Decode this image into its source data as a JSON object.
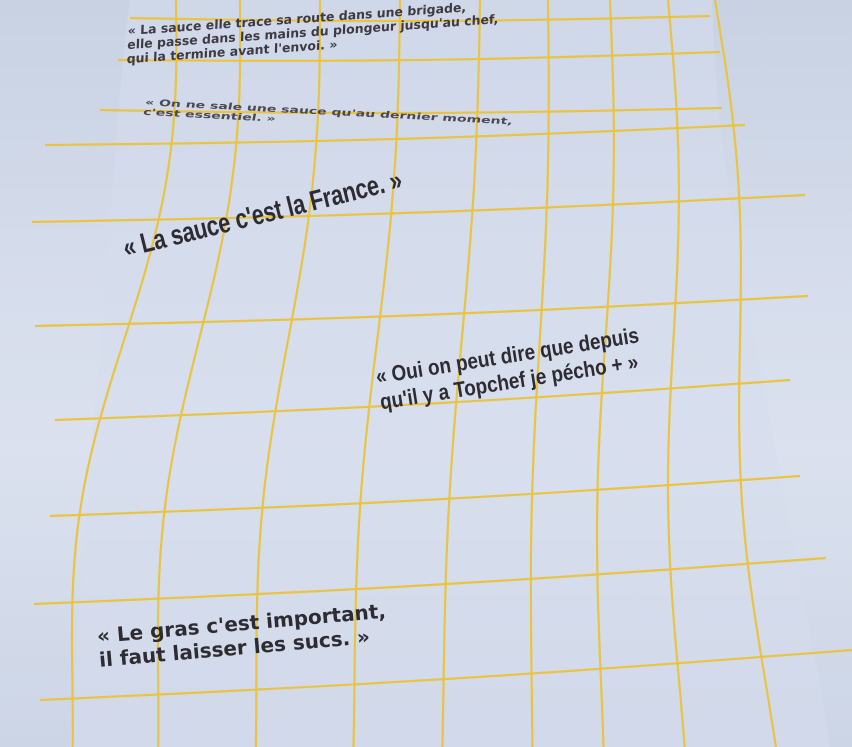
{
  "grid": {
    "color": "#e8c442",
    "paper_color": "#d6ddec"
  },
  "quotes": [
    {
      "lines": [
        "« La sauce elle trace sa route dans une brigade,",
        "elle passe dans les mains du plongeur jusqu'au chef,",
        "qui la termine avant l'envoi. »"
      ]
    },
    {
      "lines": [
        "« On ne sale une sauce qu'au dernier moment,",
        "c'est essentiel. »"
      ]
    },
    {
      "lines": [
        "« La sauce c'est la France. »"
      ]
    },
    {
      "lines": [
        "« Oui on peut dire que depuis",
        "qu'il y a Topchef je pécho + »"
      ]
    },
    {
      "lines": [
        "« Le gras c'est important,",
        "il faut laisser les sucs. »"
      ]
    }
  ]
}
